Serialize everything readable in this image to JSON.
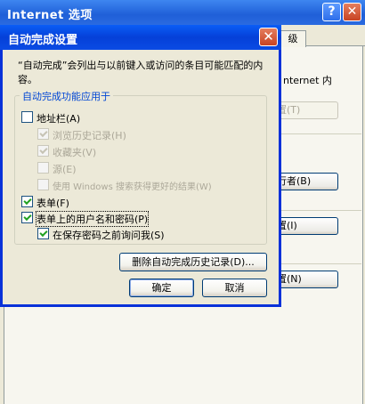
{
  "background_window": {
    "title": "Internet 选项",
    "help_button": "?",
    "close_button": "✕",
    "tab_partial": "级",
    "text_partial": "nternet 内",
    "btn1_label": "置(T)",
    "btn2_label": "行者(B)",
    "btn3_label": "置(I)",
    "btn4_label": "置(N)"
  },
  "dialog": {
    "title": "自动完成设置",
    "close_symbol": "✕",
    "description": "“自动完成”会列出与以前键入或访问的条目可能匹配的内容。",
    "group_title": "自动完成功能应用于",
    "options": [
      {
        "label": "地址栏(A)",
        "checked": false,
        "enabled": true
      },
      {
        "label": "浏览历史记录(H)",
        "checked": true,
        "enabled": false
      },
      {
        "label": "收藏夹(V)",
        "checked": true,
        "enabled": false
      },
      {
        "label": "源(E)",
        "checked": false,
        "enabled": false
      },
      {
        "label": "使用 Windows 搜索获得更好的结果(W)",
        "checked": false,
        "enabled": false
      },
      {
        "label": "表单(F)",
        "checked": true,
        "enabled": true
      },
      {
        "label": "表单上的用户名和密码(P)",
        "checked": true,
        "enabled": true
      },
      {
        "label": "在保存密码之前询问我(S)",
        "checked": true,
        "enabled": true
      }
    ],
    "delete_history_button": "删除自动完成历史记录(D)...",
    "ok_button": "确定",
    "cancel_button": "取消"
  }
}
